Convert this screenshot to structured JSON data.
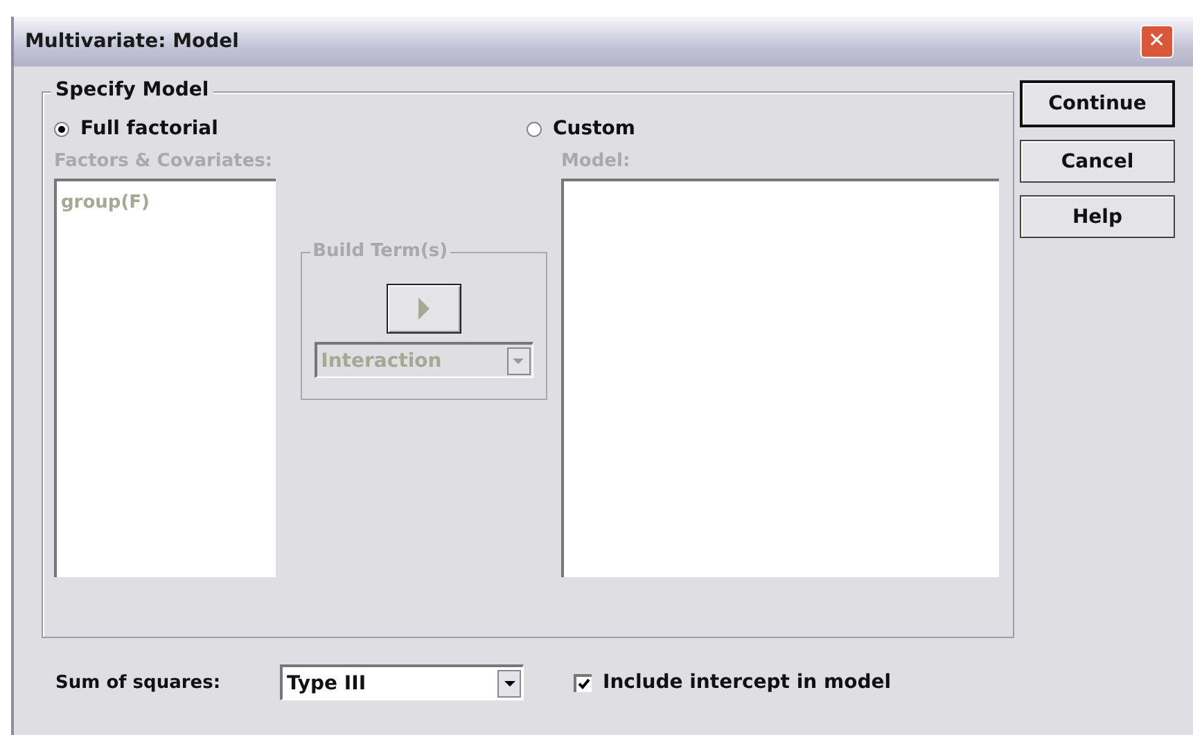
{
  "window": {
    "title": "Multivariate: Model",
    "close": "✕"
  },
  "specify_model": {
    "title": "Specify Model",
    "options": [
      {
        "label": "Full factorial",
        "selected": true
      },
      {
        "label": "Custom",
        "selected": false
      }
    ],
    "factors": {
      "label": "Factors & Covariates:",
      "disabled": true,
      "items": [
        {
          "label": "group(F)",
          "disabled": true
        }
      ]
    },
    "build_terms": {
      "title": "Build Term(s)",
      "disabled": true,
      "type": "Interaction"
    },
    "model": {
      "label": "Model:",
      "disabled": true
    }
  },
  "buttons": [
    {
      "label": "Continue",
      "default": true
    },
    {
      "label": "Cancel",
      "default": false
    },
    {
      "label": "Help",
      "default": false
    }
  ],
  "sum_of_squares": {
    "label": "Sum of squares:",
    "value": "Type III"
  },
  "include_intercept": {
    "label": "Include intercept in model",
    "checked": true
  }
}
